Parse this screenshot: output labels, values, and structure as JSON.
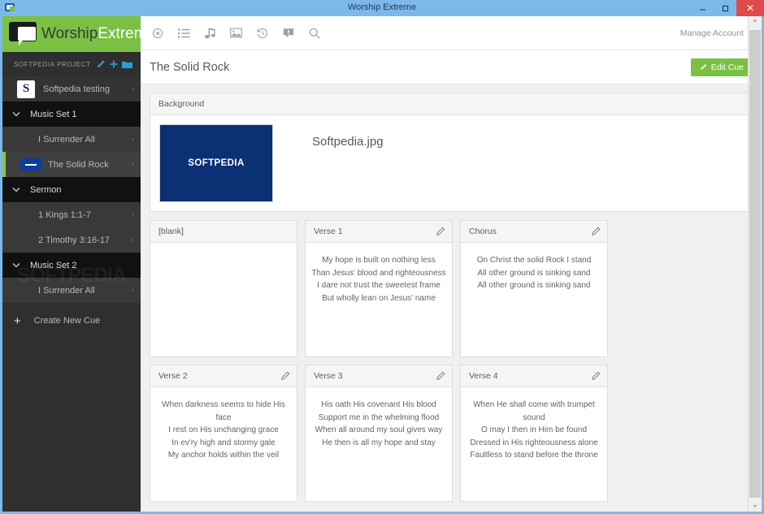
{
  "window": {
    "title": "Worship Extreme",
    "app_icon": "app-window-icon",
    "minimize_label": "–",
    "maximize_label": "☐",
    "close_label": "✕"
  },
  "brand": {
    "word_primary": "Worship",
    "word_secondary": "Extreme"
  },
  "sidebar": {
    "project_label": "SOFTPEDIA PROJECT",
    "project_actions": [
      "pencil-icon",
      "plus-icon",
      "folder-icon"
    ],
    "items": [
      {
        "label": "Softpedia testing",
        "type": "project",
        "thumb": "S",
        "arrow": "›"
      },
      {
        "label": "Music Set 1",
        "type": "group",
        "chevron": "∨"
      },
      {
        "label": "I Surrender All",
        "type": "child",
        "arrow": "›"
      },
      {
        "label": "The Solid Rock",
        "type": "child-active",
        "arrow": "›"
      },
      {
        "label": "Sermon",
        "type": "group",
        "chevron": "∨"
      },
      {
        "label": "1 Kings 1:1-7",
        "type": "child",
        "arrow": "›"
      },
      {
        "label": "2 Timothy 3:16-17",
        "type": "child",
        "arrow": "›"
      },
      {
        "label": "Music Set 2",
        "type": "group",
        "chevron": "∨"
      },
      {
        "label": "I Surrender All",
        "type": "child",
        "arrow": "›"
      }
    ],
    "create_cue_label": "Create New Cue",
    "create_cue_icon": "plus-icon",
    "watermark": "SOFTPEDIA"
  },
  "toolbar": {
    "icons": [
      "close-circle-icon",
      "list-icon",
      "music-note-icon",
      "image-icon",
      "history-icon",
      "announcement-icon",
      "search-icon"
    ],
    "account_label": "Manage Account",
    "account_caret": "▾"
  },
  "page": {
    "title": "The Solid Rock",
    "edit_button_label": "Edit Cue",
    "edit_button_icon": "pencil-icon",
    "edit_button_color": "#7ac143"
  },
  "background_panel": {
    "header": "Background",
    "thumb_text": "SOFTPEDIA",
    "thumb_color": "#0b3074",
    "file_name": "Softpedia.jpg"
  },
  "slides": [
    {
      "title": "[blank]",
      "has_edit": false,
      "lines": []
    },
    {
      "title": "Verse 1",
      "has_edit": true,
      "lines": [
        "My hope is built on nothing less",
        "Than Jesus' blood and righteousness",
        "I dare not trust the sweetest frame",
        "But wholly lean on Jesus' name"
      ]
    },
    {
      "title": "Chorus",
      "has_edit": true,
      "lines": [
        "On Christ the solid Rock I stand",
        "All other ground is sinking sand",
        "All other ground is sinking sand"
      ]
    },
    {
      "title": "Verse 2",
      "has_edit": true,
      "lines": [
        "When darkness seems to hide His face",
        "I rest on His unchanging grace",
        "In ev'ry high and stormy gale",
        "My anchor holds within the veil"
      ]
    },
    {
      "title": "Verse 3",
      "has_edit": true,
      "lines": [
        "His oath His covenant His blood",
        "Support me in the whelming flood",
        "When all around my soul gives way",
        "He then is all my hope and stay"
      ]
    },
    {
      "title": "Verse 4",
      "has_edit": true,
      "lines": [
        "When He shall come with trumpet sound",
        "O may I then in Him be found",
        "Dressed in His righteousness alone",
        "Faultless to stand before the throne"
      ]
    }
  ],
  "scrollbar": {
    "up_arrow": "⌃",
    "down_arrow": "⌄"
  }
}
